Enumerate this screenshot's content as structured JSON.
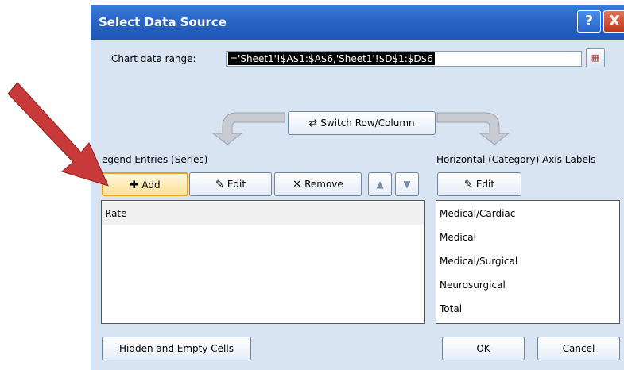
{
  "window": {
    "title": "Select Data Source",
    "help_glyph": "?",
    "close_glyph": "X"
  },
  "range": {
    "label": "Chart data range:",
    "value": "='Sheet1'!$A$1:$A$6,'Sheet1'!$D$1:$D$6"
  },
  "switch_button": {
    "label": "Switch Row/Column",
    "icon": "switch-icon"
  },
  "legend": {
    "heading": "egend Entries (Series)",
    "add_label": "Add",
    "edit_label": "Edit",
    "remove_label": "Remove",
    "items": [
      "Rate"
    ]
  },
  "axis": {
    "heading": "Horizontal (Category) Axis Labels",
    "edit_label": "Edit",
    "items": [
      "Medical/Cardiac",
      "Medical",
      "Medical/Surgical",
      "Neurosurgical",
      "Total"
    ]
  },
  "footer": {
    "hidden_cells_label": "Hidden and Empty Cells",
    "ok_label": "OK",
    "cancel_label": "Cancel"
  },
  "colors": {
    "title_bar": "#2a64c5",
    "dialog_bg": "#d9e4f2",
    "pointer_arrow": "#c83a3a",
    "selected_row": "#f0f0f0"
  }
}
